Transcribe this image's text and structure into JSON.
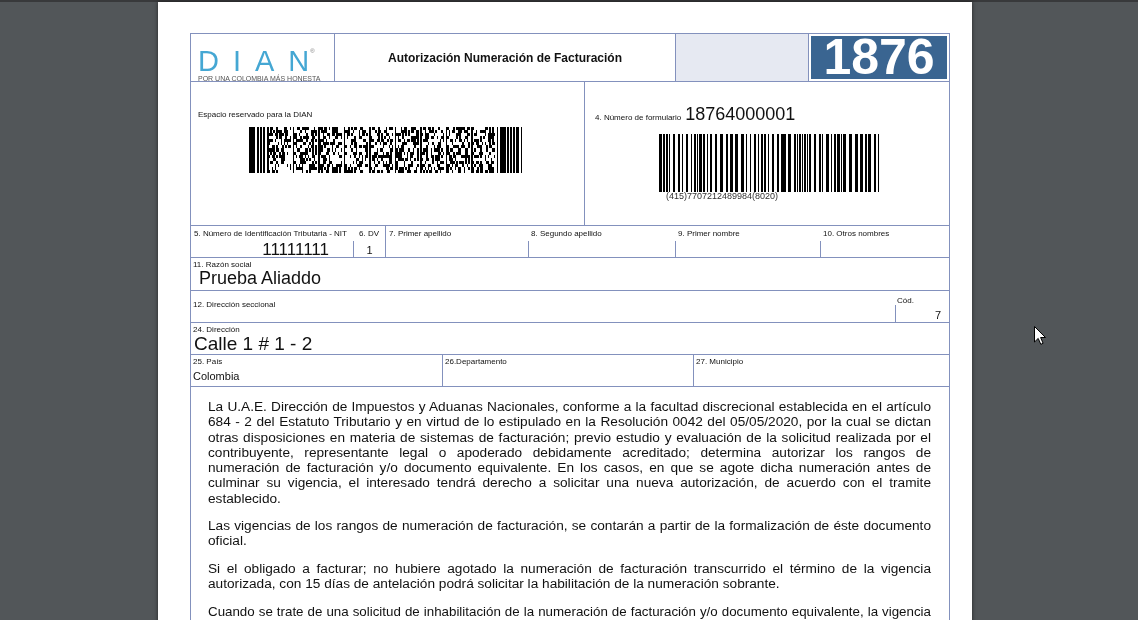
{
  "header": {
    "logo": {
      "wordmark": "DIAN$^{®}$",
      "tagline": "POR UNA COLOMBIA MÁS HONESTA"
    },
    "title": "Autorización Numeración de Facturación",
    "form_code": "1876"
  },
  "reserved_area": {
    "label": "Espacio reservado para la DIAN"
  },
  "form_number": {
    "label": "4. Número de formulario",
    "value": "18764000001",
    "barcode_text": "(415)7707212489984(8020)"
  },
  "identification_row": [
    {
      "label": "5. Número de Identificación Tributaria - NIT",
      "value": "11111111"
    },
    {
      "label": "6. DV",
      "value": "1"
    },
    {
      "label": "7. Primer apellido"
    },
    {
      "label": "8. Segundo apellido"
    },
    {
      "label": "9. Primer nombre"
    },
    {
      "label": "10. Otros nombres"
    }
  ],
  "business_name": {
    "label": "11. Razón social",
    "value": "Prueba Aliaddo"
  },
  "tax_office": {
    "label": "12. Dirección seccional",
    "code_label": "Cód.",
    "code_value": "7"
  },
  "address": {
    "label": "24. Dirección",
    "value": "Calle 1 # 1 - 2"
  },
  "location_row": [
    {
      "label": "25. País",
      "value": "Colombia"
    },
    {
      "label": "26.Departamento"
    },
    {
      "label": "27. Municipio"
    }
  ],
  "paragraphs": [
    "La U.A.E. Dirección de Impuestos y Aduanas Nacionales, conforme a la facultad discrecional establecida en el artículo 684 - 2 del Estatuto Tributario y en virtud de lo estipulado en la Resolución 0042 del 05/05/2020, por la cual se dictan otras disposiciones en materia de sistemas de facturación; previo estudio y evaluación de la solicitud realizada por el contribuyente, representante legal o apoderado debidamente acreditado; determina autorizar los rangos de numeración de facturación y/o documento equivalente. En los casos, en que se agote dicha numeración antes de culminar su vigencia, el interesado tendrá derecho a solicitar una nueva autorización, de acuerdo con el tramite establecido.",
    "Las vigencias de los rangos de numeración de facturación, se contarán a partir de la formalización de éste documento oficial.",
    "Si el obligado a facturar; no hubiere agotado la numeración de facturación transcurrido el término de la vigencia autorizada, con 15 días de antelación podrá solicitar la habilitación de la numeración sobrante.",
    "Cuando se trate de una solicitud de inhabilitación de la numeración de facturación y/o documento equivalente, la vigencia"
  ]
}
